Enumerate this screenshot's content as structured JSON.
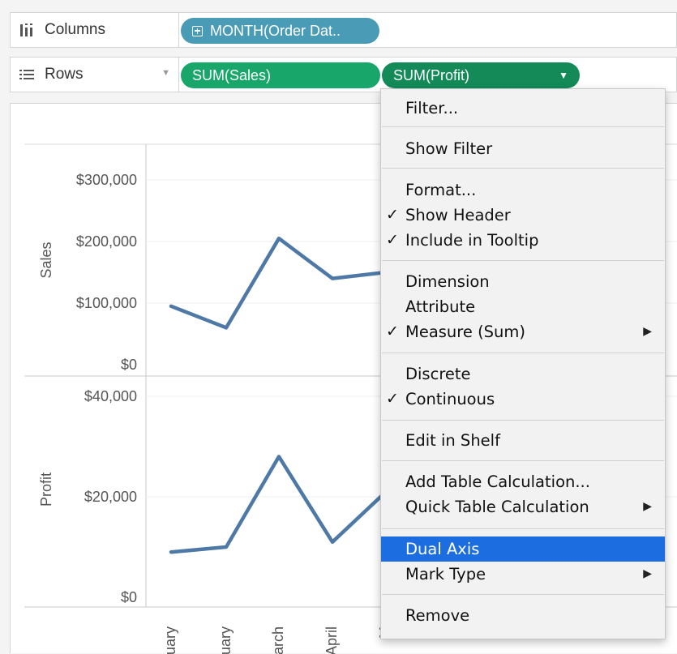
{
  "shelves": {
    "columns": {
      "label": "Columns",
      "icon": "columns-icon",
      "pill": "MONTH(Order Dat.."
    },
    "rows": {
      "label": "Rows",
      "icon": "rows-list-icon",
      "pills": [
        "SUM(Sales)",
        "SUM(Profit)"
      ]
    }
  },
  "colors": {
    "columns_pill": "#4a9bb5",
    "sales_pill": "#18a66a",
    "profit_pill": "#138a58",
    "line": "#4e79a7",
    "menu_highlight": "#1c6de0"
  },
  "context_menu": {
    "filter": "Filter...",
    "show_filter": "Show Filter",
    "format": "Format...",
    "show_header": "Show Header",
    "include_tooltip": "Include in Tooltip",
    "dimension": "Dimension",
    "attribute": "Attribute",
    "measure": "Measure (Sum)",
    "discrete": "Discrete",
    "continuous": "Continuous",
    "edit_in_shelf": "Edit in Shelf",
    "add_table_calc": "Add Table Calculation...",
    "quick_table_calc": "Quick Table Calculation",
    "dual_axis": "Dual Axis",
    "mark_type": "Mark Type",
    "remove": "Remove",
    "checkmark": "✓",
    "submenu_arrow": "▶"
  },
  "chart_data": [
    {
      "type": "line",
      "ylabel": "Sales",
      "ylim": [
        0,
        350000
      ],
      "yticks": [
        0,
        100000,
        200000,
        300000
      ],
      "ytick_labels": [
        "$0",
        "$100,000",
        "$200,000",
        "$300,000"
      ],
      "categories": [
        "January",
        "February",
        "March",
        "April",
        "May"
      ],
      "x_tick_labels": [
        "nuary",
        "ruary",
        "March",
        "April",
        "M"
      ],
      "values": [
        95000,
        60000,
        205000,
        140000,
        150000
      ]
    },
    {
      "type": "line",
      "ylabel": "Profit",
      "ylim": [
        0,
        45000
      ],
      "yticks": [
        0,
        20000,
        40000
      ],
      "ytick_labels": [
        "$0",
        "$20,000",
        "$40,000"
      ],
      "categories": [
        "January",
        "February",
        "March",
        "April",
        "May"
      ],
      "values": [
        9000,
        10000,
        28000,
        11000,
        21000
      ]
    }
  ]
}
